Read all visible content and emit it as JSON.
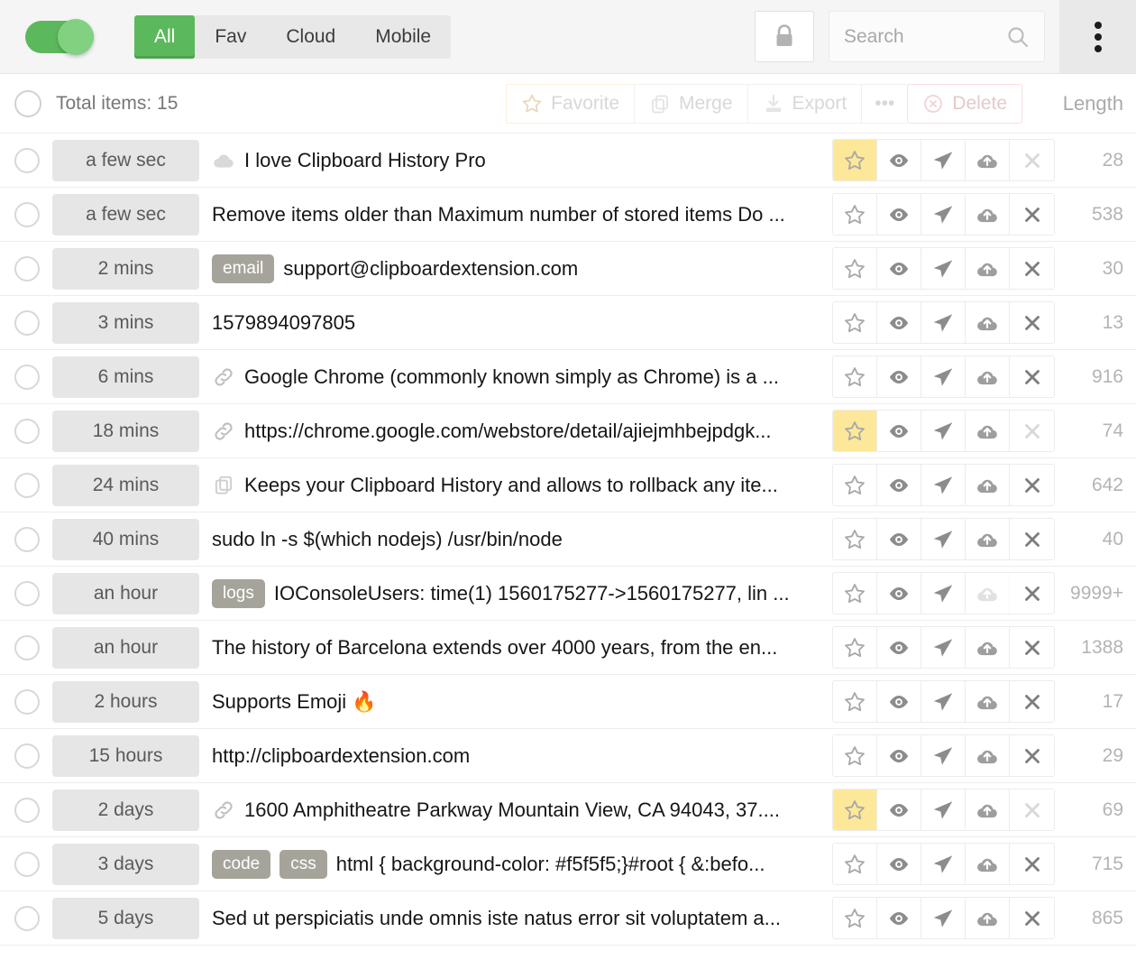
{
  "header": {
    "toggle_on": true,
    "tabs": [
      {
        "label": "All",
        "active": true
      },
      {
        "label": "Fav",
        "active": false
      },
      {
        "label": "Cloud",
        "active": false
      },
      {
        "label": "Mobile",
        "active": false
      }
    ],
    "lock_icon": "lock-icon",
    "search": {
      "placeholder": "Search",
      "value": "",
      "icon": "search-icon"
    },
    "menu_icon": "kebab-menu-icon"
  },
  "toolbar": {
    "select_all_checked": false,
    "total_label": "Total items: 15",
    "favorite_label": "Favorite",
    "merge_label": "Merge",
    "export_label": "Export",
    "more_label": "•••",
    "delete_label": "Delete",
    "length_header": "Length"
  },
  "colors": {
    "accent_green": "#5cb85c",
    "favorite_yellow": "#fde89a",
    "tag_gray": "#a6a49a",
    "delete_border": "#fbdede",
    "favorite_border": "#fbf0dc"
  },
  "rows": [
    {
      "time": "a few sec",
      "icon": "cloud-icon",
      "tags": [],
      "text": "I love Clipboard History Pro",
      "length": "28",
      "favorite": true,
      "cloud_dim": false,
      "close_dim": true
    },
    {
      "time": "a few sec",
      "icon": "",
      "tags": [],
      "text": "Remove items older than Maximum number of stored items Do ...",
      "length": "538",
      "favorite": false,
      "cloud_dim": false,
      "close_dim": false
    },
    {
      "time": "2 mins",
      "icon": "",
      "tags": [
        "email"
      ],
      "text": "support@clipboardextension.com",
      "length": "30",
      "favorite": false,
      "cloud_dim": false,
      "close_dim": false
    },
    {
      "time": "3 mins",
      "icon": "",
      "tags": [],
      "text": "1579894097805",
      "length": "13",
      "favorite": false,
      "cloud_dim": false,
      "close_dim": false
    },
    {
      "time": "6 mins",
      "icon": "link-icon",
      "tags": [],
      "text": "Google Chrome (commonly known simply as Chrome) is a ...",
      "length": "916",
      "favorite": false,
      "cloud_dim": false,
      "close_dim": false
    },
    {
      "time": "18 mins",
      "icon": "link-icon",
      "tags": [],
      "text": "https://chrome.google.com/webstore/detail/ajiejmhbejpdgk...",
      "length": "74",
      "favorite": true,
      "cloud_dim": false,
      "close_dim": true
    },
    {
      "time": "24 mins",
      "icon": "copy-icon",
      "tags": [],
      "text": "Keeps your Clipboard History and allows to rollback any ite...",
      "length": "642",
      "favorite": false,
      "cloud_dim": false,
      "close_dim": false
    },
    {
      "time": "40 mins",
      "icon": "",
      "tags": [],
      "text": "sudo ln -s $(which nodejs) /usr/bin/node",
      "length": "40",
      "favorite": false,
      "cloud_dim": false,
      "close_dim": false
    },
    {
      "time": "an hour",
      "icon": "",
      "tags": [
        "logs"
      ],
      "text": "IOConsoleUsers: time(1) 1560175277->1560175277, lin ...",
      "length": "9999+",
      "favorite": false,
      "cloud_dim": true,
      "close_dim": false
    },
    {
      "time": "an hour",
      "icon": "",
      "tags": [],
      "text": "The history of Barcelona extends over 4000 years, from the en...",
      "length": "1388",
      "favorite": false,
      "cloud_dim": false,
      "close_dim": false
    },
    {
      "time": "2 hours",
      "icon": "",
      "tags": [],
      "text": "Supports Emoji 🔥",
      "length": "17",
      "favorite": false,
      "cloud_dim": false,
      "close_dim": false
    },
    {
      "time": "15 hours",
      "icon": "",
      "tags": [],
      "text": "http://clipboardextension.com",
      "length": "29",
      "favorite": false,
      "cloud_dim": false,
      "close_dim": false
    },
    {
      "time": "2 days",
      "icon": "link-icon",
      "tags": [],
      "text": "1600 Amphitheatre Parkway Mountain View, CA 94043, 37....",
      "length": "69",
      "favorite": true,
      "cloud_dim": false,
      "close_dim": true
    },
    {
      "time": "3 days",
      "icon": "",
      "tags": [
        "code",
        "css"
      ],
      "text": "html { background-color: #f5f5f5;}#root { &:befo...",
      "length": "715",
      "favorite": false,
      "cloud_dim": false,
      "close_dim": false
    },
    {
      "time": "5 days",
      "icon": "",
      "tags": [],
      "text": "Sed ut perspiciatis unde omnis iste natus error sit voluptatem a...",
      "length": "865",
      "favorite": false,
      "cloud_dim": false,
      "close_dim": false
    }
  ],
  "row_actions": [
    "favorite",
    "preview",
    "send",
    "cloud-upload",
    "close"
  ]
}
